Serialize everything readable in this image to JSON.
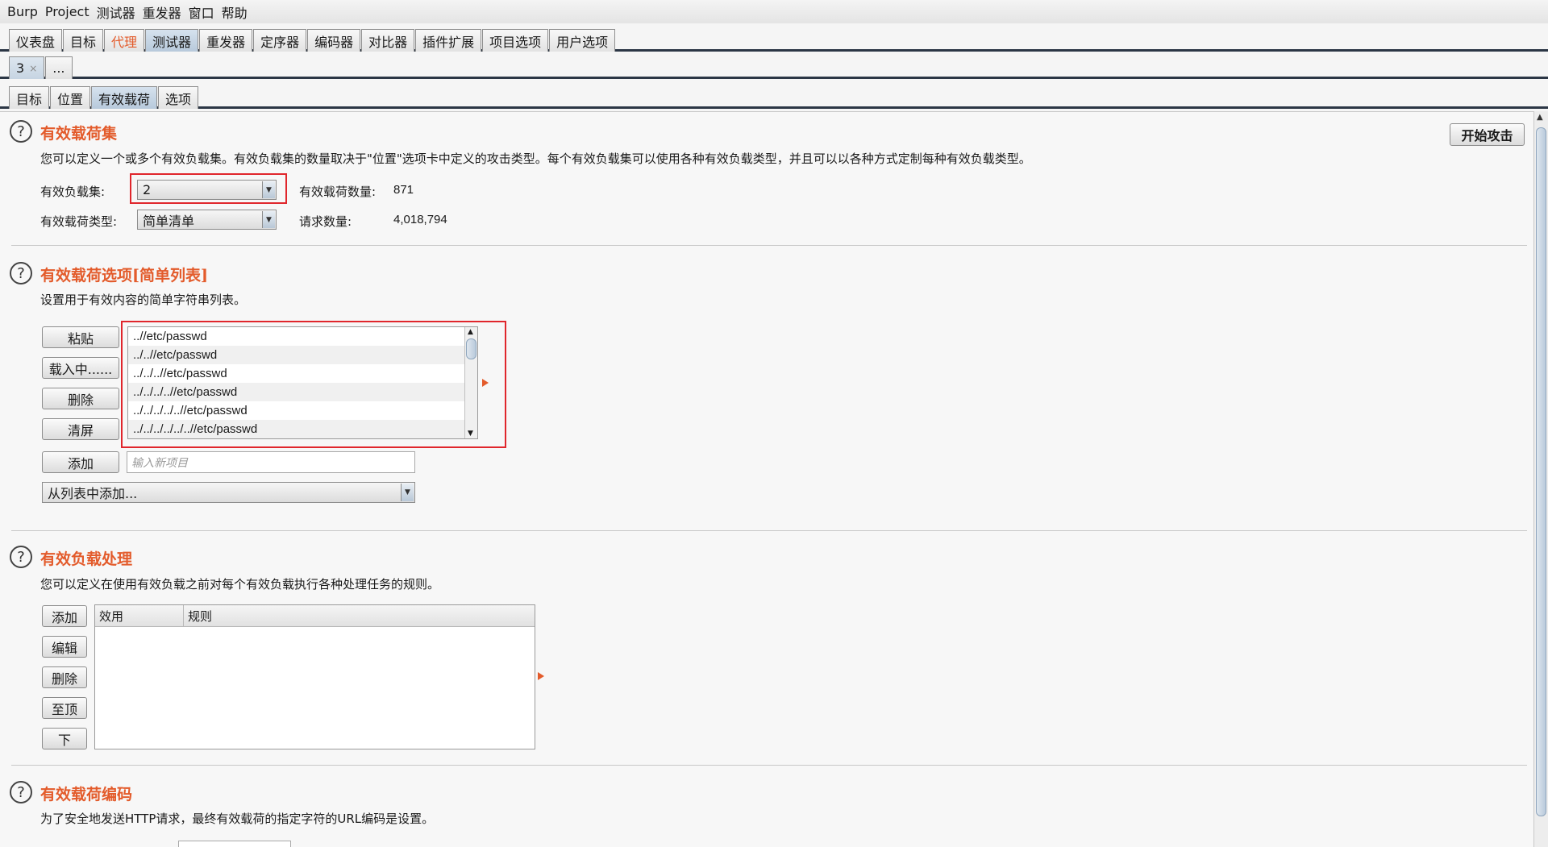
{
  "menubar": {
    "items": [
      "Burp",
      "Project",
      "测试器",
      "重发器",
      "窗口",
      "帮助"
    ]
  },
  "main_tabs": [
    "仪表盘",
    "目标",
    "代理",
    "测试器",
    "重发器",
    "定序器",
    "编码器",
    "对比器",
    "插件扩展",
    "项目选项",
    "用户选项"
  ],
  "instance_tabs": {
    "current": "3",
    "close": "×",
    "more": "..."
  },
  "sub_tabs": [
    "目标",
    "位置",
    "有效载荷",
    "选项"
  ],
  "start_attack_label": "开始攻击",
  "payload_sets": {
    "title": "有效载荷集",
    "description": "您可以定义一个或多个有效负载集。有效负载集的数量取决于\"位置\"选项卡中定义的攻击类型。每个有效负载集可以使用各种有效负载类型，并且可以以各种方式定制每种有效负载类型。",
    "set_label": "有效负载集:",
    "set_value": "2",
    "type_label": "有效载荷类型:",
    "type_value": "简单清单",
    "count_label": "有效载荷数量:",
    "count_value": "871",
    "requests_label": "请求数量:",
    "requests_value": "4,018,794"
  },
  "payload_options": {
    "title": "有效载荷选项[简单列表]",
    "description": "设置用于有效内容的简单字符串列表。",
    "buttons": {
      "paste": "粘贴",
      "load": "载入中......",
      "remove": "删除",
      "clear": "清屏",
      "add": "添加"
    },
    "items": [
      "..//etc/passwd",
      "../..//etc/passwd",
      "../../..//etc/passwd",
      "../../../..//etc/passwd",
      "../../../../..//etc/passwd",
      "../../../../../..//etc/passwd"
    ],
    "new_item_placeholder": "输入新项目",
    "add_from_list": "从列表中添加..."
  },
  "payload_processing": {
    "title": "有效负载处理",
    "description": "您可以定义在使用有效负载之前对每个有效负载执行各种处理任务的规则。",
    "buttons": {
      "add": "添加",
      "edit": "编辑",
      "remove": "删除",
      "top": "至顶",
      "down": "下"
    },
    "columns": [
      "效用",
      "规则"
    ]
  },
  "payload_encoding": {
    "title": "有效载荷编码",
    "description": "为了安全地发送HTTP请求，最终有效载荷的指定字符的URL编码是设置。"
  },
  "colors": {
    "accent": "#e35b2b",
    "selected_tab": "#b7c9db",
    "highlight_box": "#e0262c"
  }
}
